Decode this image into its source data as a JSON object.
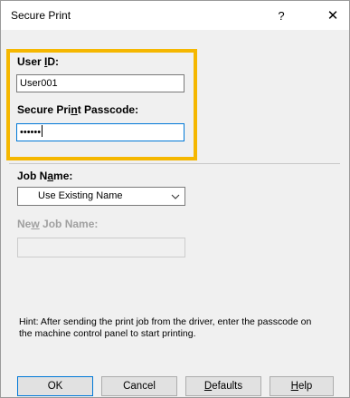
{
  "window": {
    "title": "Secure Print",
    "help_glyph": "?",
    "close_glyph": "✕"
  },
  "form": {
    "user_id": {
      "label_pre": "User ",
      "label_ul": "I",
      "label_post": "D:",
      "value": "User001"
    },
    "passcode": {
      "label_pre": "Secure Pri",
      "label_ul": "n",
      "label_post": "t Passcode:",
      "value_masked": "••••••"
    },
    "job_name": {
      "label_pre": "Job N",
      "label_ul": "a",
      "label_post": "me:",
      "selected": "Use Existing Name"
    },
    "new_job_name": {
      "label_pre": "Ne",
      "label_ul": "w",
      "label_post": " Job Name:",
      "value": ""
    }
  },
  "hint": "Hint: After sending the print job from the driver, enter the passcode on the machine control panel to start printing.",
  "buttons": {
    "ok": "OK",
    "cancel": "Cancel",
    "defaults_ul": "D",
    "defaults_rest": "efaults",
    "help_ul": "H",
    "help_rest": "elp"
  },
  "colors": {
    "highlight": "#f5b700",
    "focus_border": "#0078d7",
    "dialog_bg": "#f0f0f0"
  },
  "icons": {
    "dropdown": "chevron-down-icon"
  }
}
